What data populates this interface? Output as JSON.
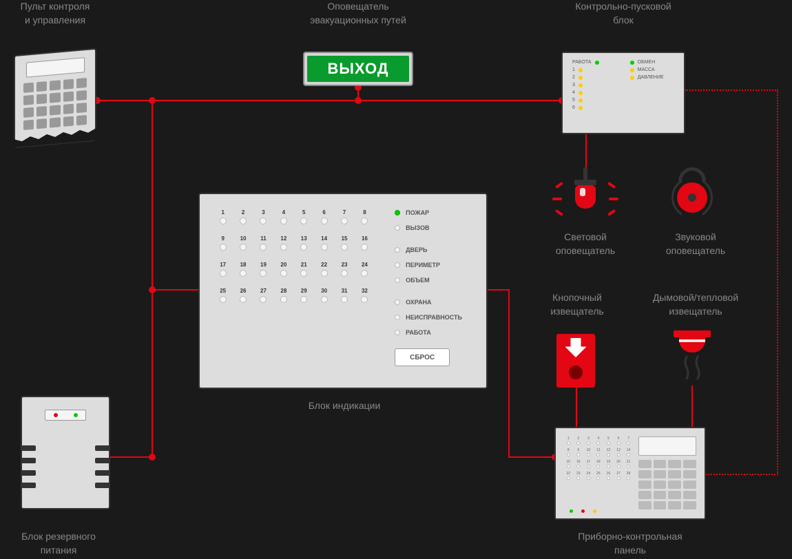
{
  "labels": {
    "keypad": "Пульт контроля\nи управления",
    "exit_sign": "Оповещатель\nэвакуационных путей",
    "ctrl_block": "Контрольно-пусковой\nблок",
    "ind_block": "Блок индикации",
    "psu": "Блок резервного\nпитания",
    "beacon": "Световой\nоповещатель",
    "bell": "Звуковой\nоповещатель",
    "callpoint": "Кнопочный\nизвещатель",
    "smoke": "Дымовой/тепловой\nизвещатель",
    "panel": "Приборно-контрольная\nпанель"
  },
  "exit_text": "ВЫХОД",
  "ctrl_block": {
    "left_rows": [
      "РАБОТА",
      "1",
      "2",
      "3",
      "4",
      "5",
      "6"
    ],
    "right_rows": [
      "ОБМЕН",
      "МАССА",
      "ДАВЛЕНИЕ"
    ]
  },
  "ind_block": {
    "zones": 32,
    "status": [
      "ПОЖАР",
      "ВЫЗОВ",
      "ДВЕРЬ",
      "ПЕРИМЕТР",
      "ОБЪЕМ",
      "ОХРАНА",
      "НЕИСПРАВНОСТЬ",
      "РАБОТА"
    ],
    "status_spacer_after": [
      1,
      4
    ],
    "status_active_index": 0,
    "reset_label": "СБРОС"
  },
  "panel": {
    "zones": 28
  }
}
